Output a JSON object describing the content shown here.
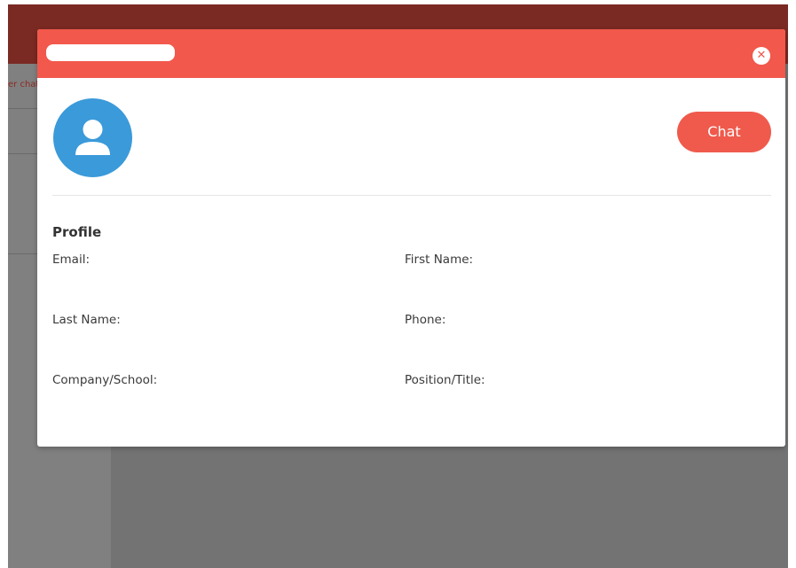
{
  "background": {
    "sidebar_link": "er chat"
  },
  "modal": {
    "title": "",
    "close_icon": "close-icon",
    "avatar_icon": "user-icon",
    "chat_label": "Chat",
    "section_title": "Profile",
    "fields": {
      "email": "Email:",
      "first_name": "First Name:",
      "last_name": "Last Name:",
      "phone": "Phone:",
      "company": "Company/School:",
      "position": "Position/Title:"
    }
  },
  "colors": {
    "header": "#f2584b",
    "topbar": "#7a2a23",
    "accent": "#ef5a4c",
    "avatar": "#3b9ad9"
  }
}
